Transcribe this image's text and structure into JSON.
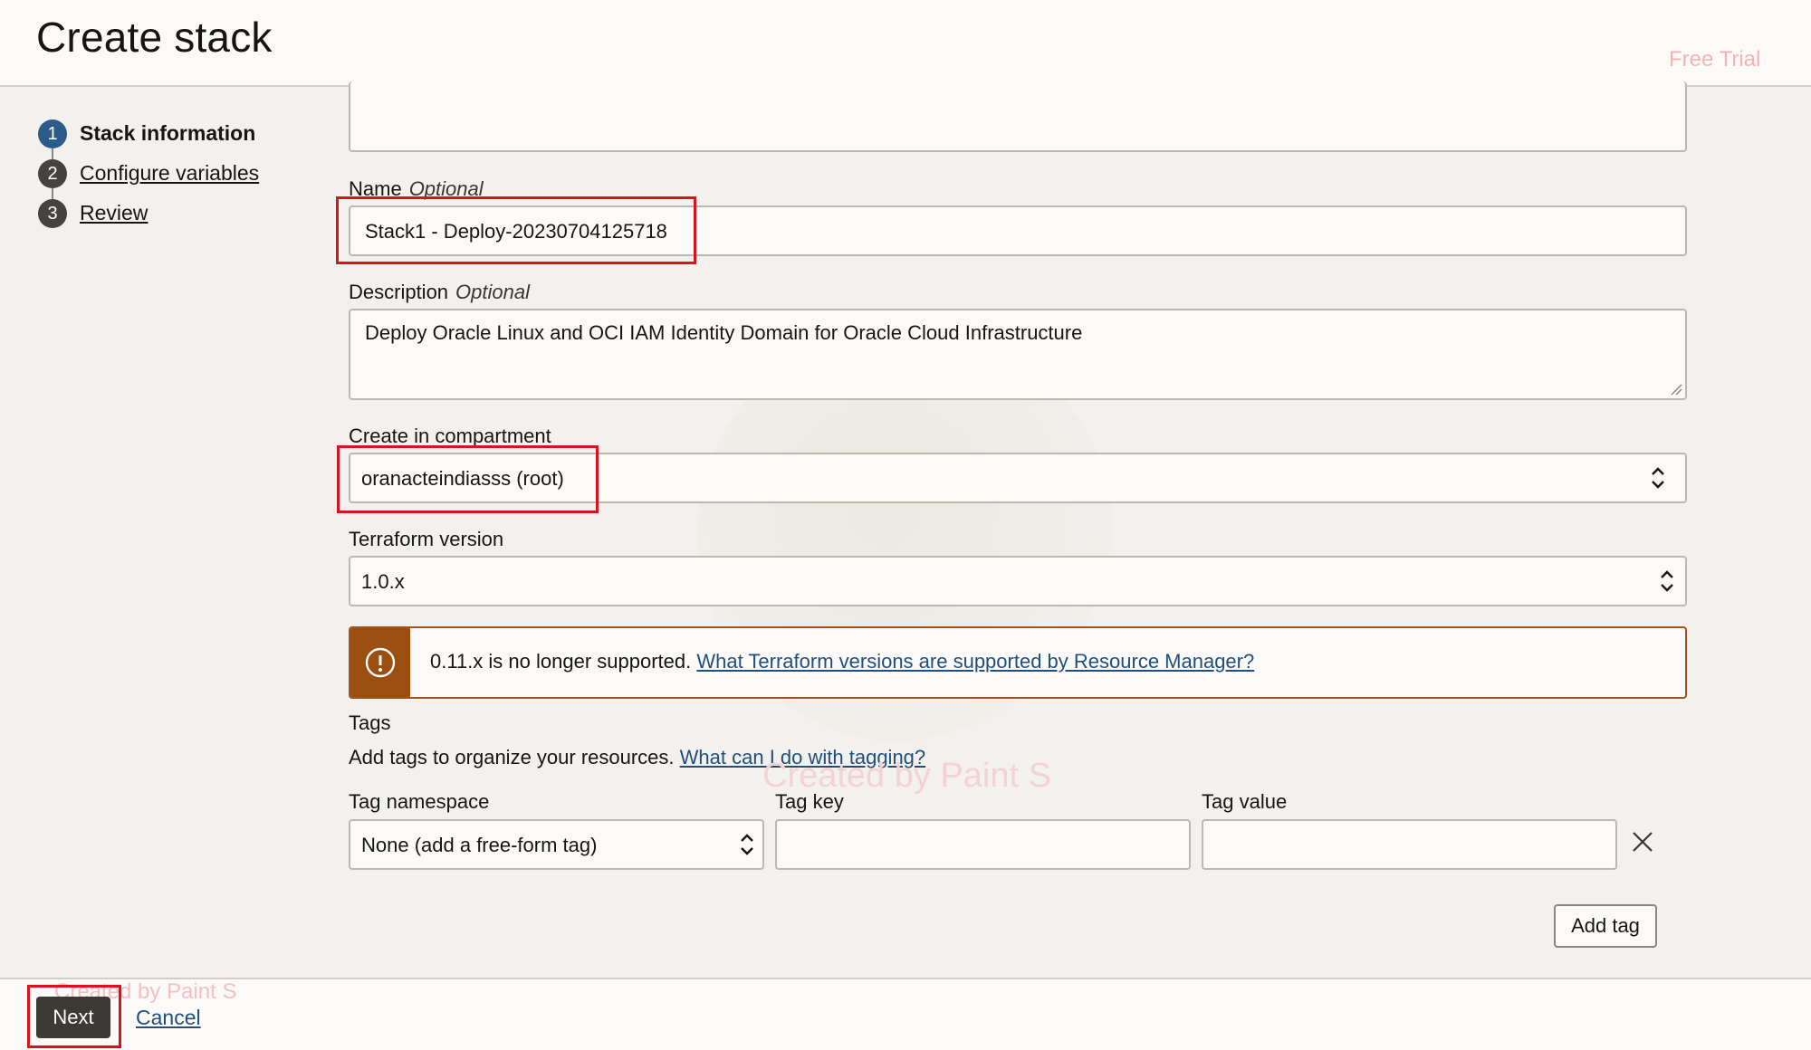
{
  "header": {
    "title": "Create stack",
    "watermark": "Free Trial"
  },
  "steps": [
    {
      "num": "1",
      "label": "Stack information"
    },
    {
      "num": "2",
      "label": "Configure variables"
    },
    {
      "num": "3",
      "label": "Review"
    }
  ],
  "form": {
    "name": {
      "label": "Name",
      "optional": "Optional",
      "value": "Stack1 - Deploy-20230704125718"
    },
    "description": {
      "label": "Description",
      "optional": "Optional",
      "value": "Deploy Oracle Linux and OCI IAM Identity Domain for Oracle Cloud Infrastructure"
    },
    "compartment": {
      "label": "Create in compartment",
      "value": "oranacteindiasss (root)"
    },
    "terraform": {
      "label": "Terraform version",
      "value": "1.0.x"
    },
    "warning": {
      "text": "0.11.x is no longer supported. ",
      "link": "What Terraform versions are supported by Resource Manager?"
    },
    "tags": {
      "heading": "Tags",
      "help": "Add tags to organize your resources. ",
      "help_link": "What can I do with tagging?",
      "namespace_label": "Tag namespace",
      "namespace_value": "None (add a free-form tag)",
      "key_label": "Tag key",
      "value_label": "Tag value",
      "key_value": "",
      "value_value": "",
      "add_label": "Add tag"
    }
  },
  "footer": {
    "next": "Next",
    "cancel": "Cancel",
    "watermark": "Created by Paint S"
  },
  "watermarks": {
    "center": "Created by Paint S"
  },
  "colors": {
    "highlight": "#d8121e",
    "warning": "#9a4e10",
    "link": "#1f4f7a",
    "active_step": "#2a5b8a"
  },
  "icons": {
    "warning": "exclamation-circle-icon",
    "remove": "close-icon",
    "select": "chevron-up-down-icon"
  }
}
